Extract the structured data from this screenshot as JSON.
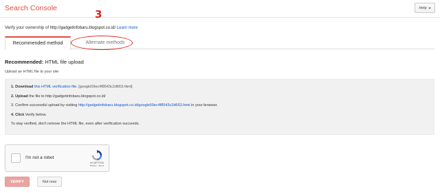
{
  "header": {
    "app_title": "Search Console",
    "help_label": "Help"
  },
  "annotation": {
    "step_number": "3"
  },
  "verify": {
    "prefix": "Verify your ownership of ",
    "site": "http://gadgetinfobaru.blogspot.co.id/",
    "learn_more": "Learn more"
  },
  "tabs": [
    {
      "label": "Recommended method"
    },
    {
      "label": "Alternate methods"
    }
  ],
  "method": {
    "title_bold": "Recommended:",
    "title_rest": " HTML file upload",
    "intro": "Upload an HTML file to your site"
  },
  "steps": {
    "s1_num": "1. Download",
    "s1_link": "this HTML verification file",
    "s1_rest": ". [google59ec4f8543c2d663.html]",
    "s2_num": "2. Upload",
    "s2_rest": " the file to http://gadgetinfobaru.blogspot.co.id/",
    "s3_text": "3. Confirm successful upload by visiting ",
    "s3_link": "http://gadgetinfobaru.blogspot.co.id/google59ec4f8543c2d663.html",
    "s3_rest": " in your browser.",
    "s4_num": "4. Click",
    "s4_rest": " Verify below.",
    "note": "To stay verified, don't remove the HTML file, even after verification succeeds."
  },
  "recaptcha": {
    "label": "I'm not a robot",
    "brand": "reCAPTCHA",
    "links": "Privacy - Terms"
  },
  "buttons": {
    "verify": "VERIFY",
    "not_now": "Not now"
  },
  "colors": {
    "brand_red": "#dd4b39",
    "link_blue": "#1155cc",
    "annotation_red": "#e02020"
  }
}
